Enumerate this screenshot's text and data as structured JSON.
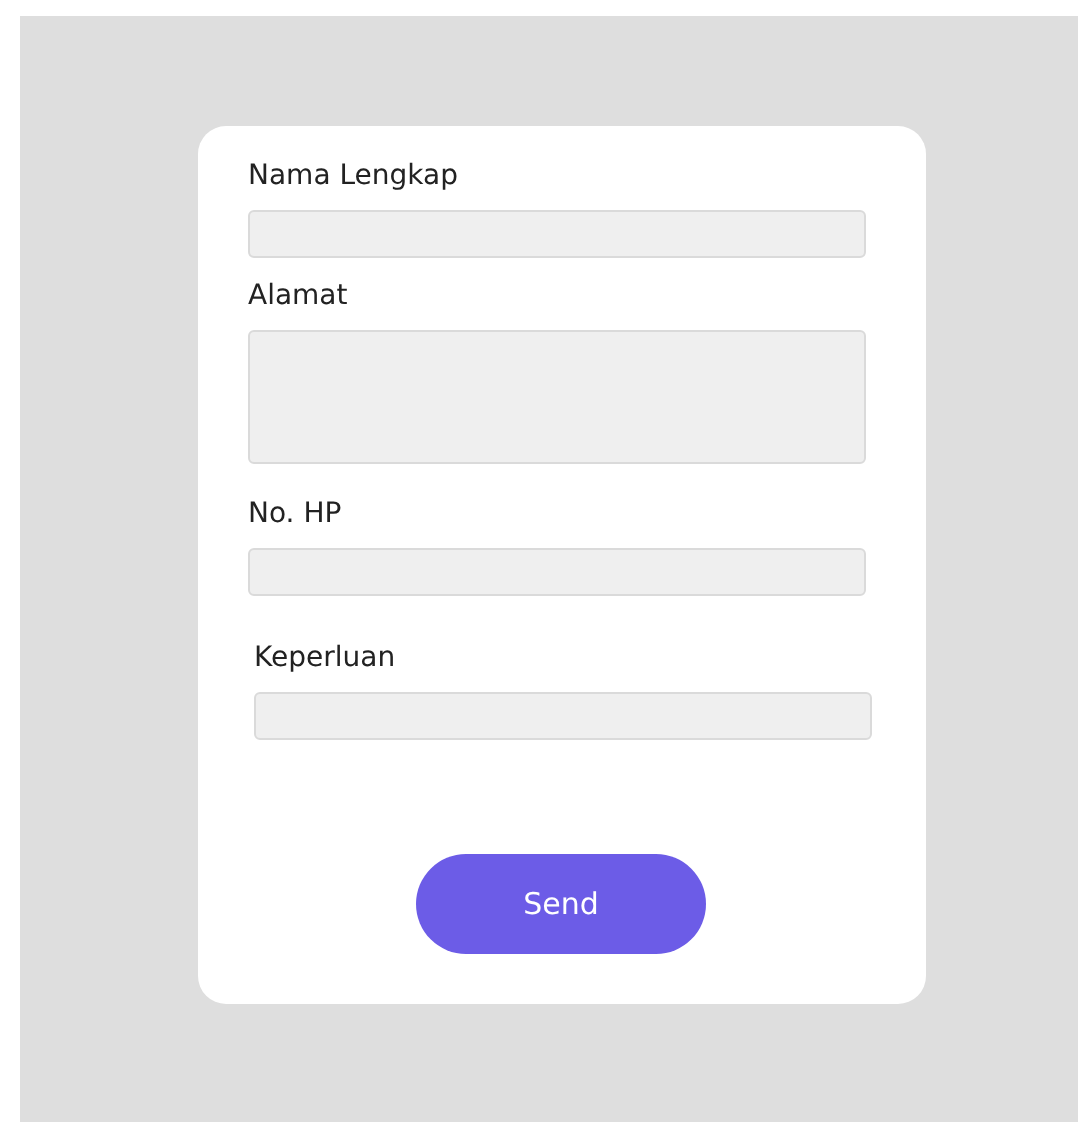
{
  "form": {
    "fields": [
      {
        "label": "Nama Lengkap",
        "kind": "input"
      },
      {
        "label": "Alamat",
        "kind": "textarea"
      },
      {
        "label": "No. HP",
        "kind": "input"
      },
      {
        "label": "Keperluan",
        "kind": "input"
      }
    ],
    "submit": "Send"
  }
}
